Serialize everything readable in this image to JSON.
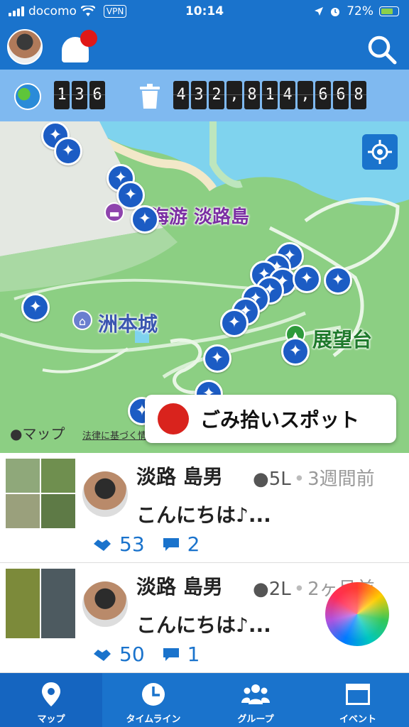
{
  "status_bar": {
    "carrier": "docomo",
    "vpn": "VPN",
    "time": "10:14",
    "battery": "72%"
  },
  "counter": {
    "participants": "136",
    "trash_total": "432,814,668"
  },
  "map": {
    "labels": {
      "hotel": "海游 淡路島",
      "castle": "洲本城",
      "observatory": "展望台"
    },
    "attribution": "マップ",
    "legal": "法律に基づく情",
    "spot_button": "ごみ拾いスポット"
  },
  "posts": [
    {
      "user": "淡路 島男",
      "amount": "5L",
      "ago": "3週間前",
      "text": "こんにちは♪...",
      "thanks": "53",
      "comments": "2"
    },
    {
      "user": "淡路 島男",
      "amount": "2L",
      "ago": "2ヶ月前",
      "text": "こんにちは♪...",
      "thanks": "50",
      "comments": "1"
    }
  ],
  "tabs": [
    {
      "label": "マップ",
      "icon": "map-pin-icon"
    },
    {
      "label": "タイムライン",
      "icon": "clock-icon"
    },
    {
      "label": "グループ",
      "icon": "group-icon"
    },
    {
      "label": "イベント",
      "icon": "calendar-icon"
    }
  ],
  "colors": {
    "primary": "#1a73cc",
    "counter_bg": "#7fb9f0",
    "pin": "#1c5cc4",
    "alert": "#e01818"
  }
}
